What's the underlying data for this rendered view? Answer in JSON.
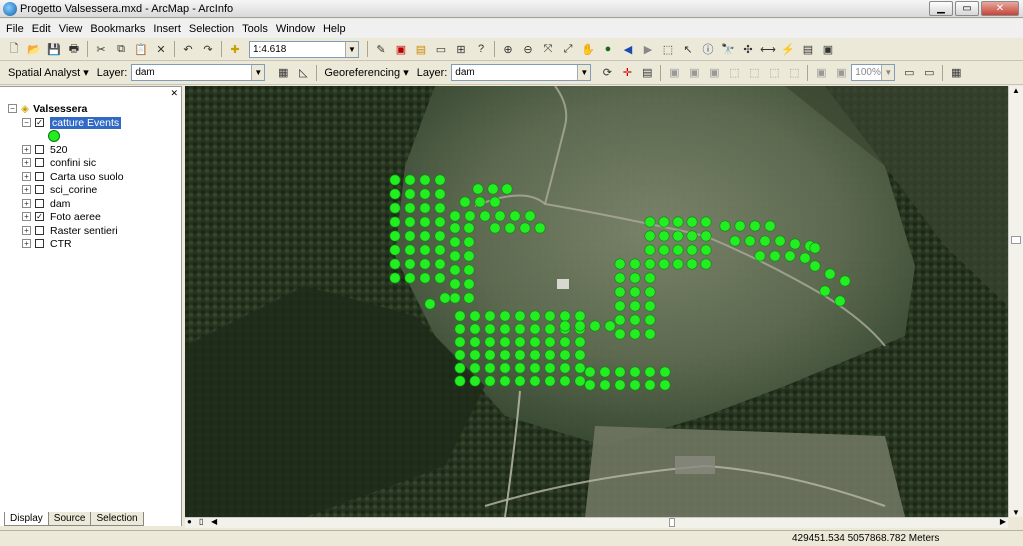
{
  "window": {
    "title": "Progetto Valsessera.mxd - ArcMap - ArcInfo"
  },
  "menu": [
    "File",
    "Edit",
    "View",
    "Bookmarks",
    "Insert",
    "Selection",
    "Tools",
    "Window",
    "Help"
  ],
  "toolbar1": {
    "scale": "1:4.618"
  },
  "toolbar2": {
    "spatial_analyst": "Spatial Analyst",
    "layer_label": "Layer:",
    "layer_value": "dam",
    "georeferencing": "Georeferencing",
    "layer2_label": "Layer:",
    "layer2_value": "dam",
    "zoom": "100%"
  },
  "toc": {
    "root": "Valsessera",
    "layers": [
      {
        "name": "catture Events",
        "checked": true,
        "selected": true
      },
      {
        "name": "520",
        "checked": false
      },
      {
        "name": "confini sic",
        "checked": false
      },
      {
        "name": "Carta uso suolo",
        "checked": false
      },
      {
        "name": "sci_corine",
        "checked": false
      },
      {
        "name": "dam",
        "checked": false
      },
      {
        "name": "Foto aeree",
        "checked": true
      },
      {
        "name": "Raster sentieri",
        "checked": false
      },
      {
        "name": "CTR",
        "checked": false
      }
    ],
    "tabs": [
      "Display",
      "Source",
      "Selection"
    ]
  },
  "map": {
    "point_color": "#22ee22"
  },
  "status": {
    "coordinates": "429451.534  5057868.782 Meters"
  }
}
